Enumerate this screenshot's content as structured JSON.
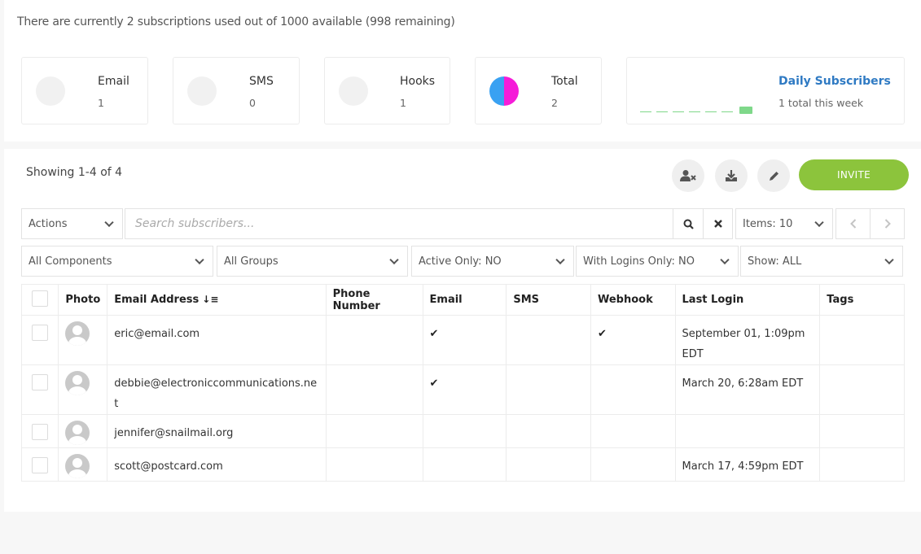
{
  "summary": "There are currently 2 subscriptions used out of 1000 available (998 remaining)",
  "stats": {
    "email": {
      "label": "Email",
      "value": "1"
    },
    "sms": {
      "label": "SMS",
      "value": "0"
    },
    "hooks": {
      "label": "Hooks",
      "value": "1"
    },
    "total": {
      "label": "Total",
      "value": "2"
    },
    "daily": {
      "label": "Daily Subscribers",
      "value": "1 total this week",
      "week_counts": [
        0,
        0,
        0,
        0,
        0,
        0,
        1
      ]
    }
  },
  "colors": {
    "accent": "#8cc43c",
    "email_pie": "#39a1f2",
    "hooks_pie": "#f51cd8",
    "link": "#2f7ac3"
  },
  "toolbar": {
    "showing": "Showing 1-4 of 4",
    "remove_icon": "user-remove-icon",
    "download_icon": "download-icon",
    "edit_icon": "pencil-icon",
    "invite_label": "INVITE"
  },
  "filters": {
    "actions": "Actions",
    "search_placeholder": "Search subscribers...",
    "items": "Items: 10",
    "components": "All Components",
    "groups": "All Groups",
    "active_only": "Active Only: NO",
    "with_logins": "With Logins Only: NO",
    "show": "Show: ALL"
  },
  "table": {
    "headers": [
      "Photo",
      "Email Address",
      "Phone Number",
      "Email",
      "SMS",
      "Webhook",
      "Last Login",
      "Tags"
    ],
    "rows": [
      {
        "email": "eric@email.com",
        "phone": "",
        "email_sub": "✔",
        "sms": "",
        "webhook": "✔",
        "last_login": "September 01, 1:09pm EDT",
        "tags": ""
      },
      {
        "email": "debbie@electroniccommunications.net",
        "phone": "",
        "email_sub": "✔",
        "sms": "",
        "webhook": "",
        "last_login": "March 20, 6:28am EDT",
        "tags": ""
      },
      {
        "email": "jennifer@snailmail.org",
        "phone": "",
        "email_sub": "",
        "sms": "",
        "webhook": "",
        "last_login": "",
        "tags": ""
      },
      {
        "email": "scott@postcard.com",
        "phone": "",
        "email_sub": "",
        "sms": "",
        "webhook": "",
        "last_login": "March 17, 4:59pm EDT",
        "tags": ""
      }
    ]
  }
}
